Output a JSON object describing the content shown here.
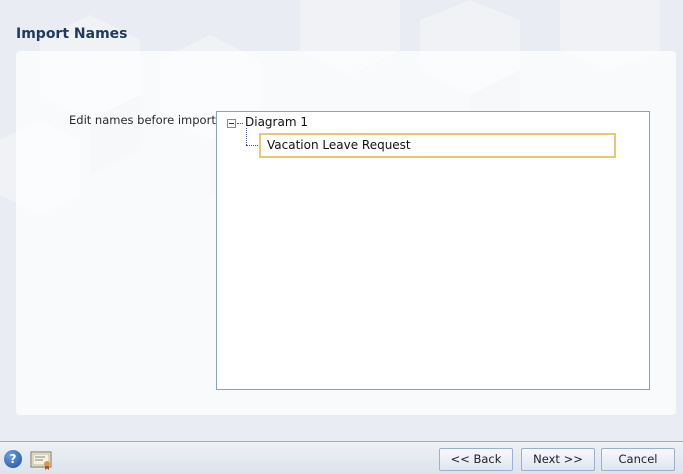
{
  "dialog": {
    "title": "Import Names",
    "field_label": "Edit names before import:"
  },
  "tree": {
    "root": {
      "label": "Diagram 1",
      "expanded": true,
      "children": [
        {
          "label": "Vacation Leave Request",
          "editing": true
        }
      ]
    }
  },
  "footer": {
    "help_icon": "help-icon",
    "certificate_icon": "certificate-icon",
    "back_label": "<< Back",
    "next_label": "Next >>",
    "cancel_label": "Cancel"
  },
  "colors": {
    "title": "#1e3a5c",
    "edit_border": "#e8c875",
    "tree_border": "#8aa1bf",
    "background": "#e9ecf2"
  }
}
